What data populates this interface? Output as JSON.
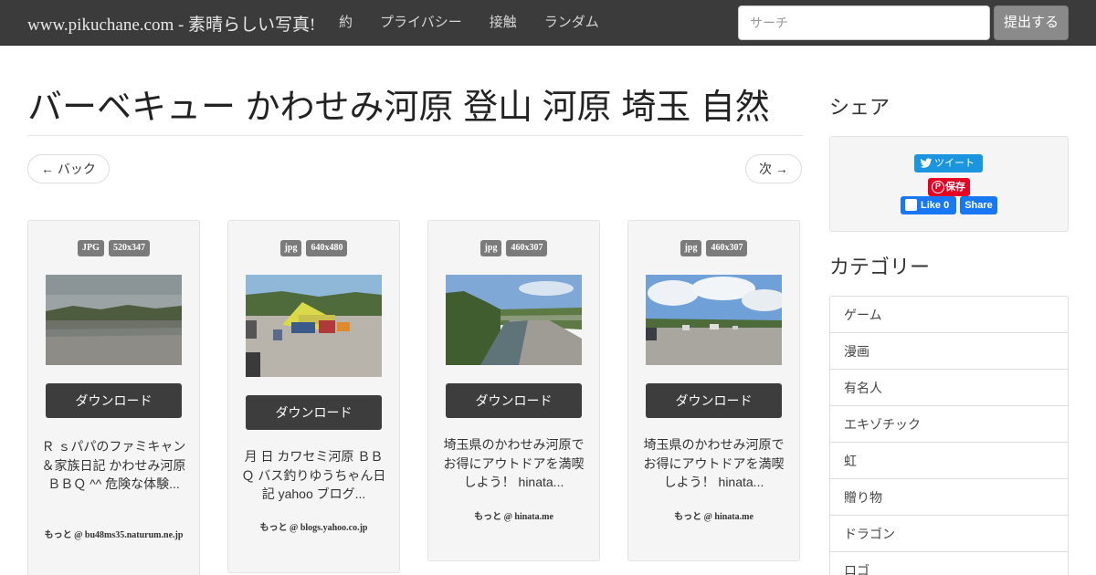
{
  "navbar": {
    "brand": "www.pikuchane.com - 素晴らしい写真!",
    "links": [
      "約",
      "プライバシー",
      "接触",
      "ランダム"
    ],
    "search_placeholder": "サーチ",
    "submit_label": "提出する"
  },
  "page": {
    "title": "バーベキュー かわせみ河原 登山 河原 埼玉 自然",
    "back_label": "← バック",
    "next_label": "次 →"
  },
  "cards": [
    {
      "format": "JPG",
      "size": "520x347",
      "download_label": "ダウンロード",
      "description": "Ｒ ｓパパのファミキャン＆家族日記 かわせみ河原ＢＢＱ ^^ 危険な体験...",
      "source": "もっと @ bu48ms35.naturum.ne.jp"
    },
    {
      "format": "jpg",
      "size": "640x480",
      "download_label": "ダウンロード",
      "description": "月 日 カワセミ河原 ＢＢＱ バス釣りゆうちゃん日記 yahoo ブログ...",
      "source": "もっと @ blogs.yahoo.co.jp"
    },
    {
      "format": "jpg",
      "size": "460x307",
      "download_label": "ダウンロード",
      "description": "埼玉県のかわせみ河原でお得にアウトドアを満喫しよう！ hinata...",
      "source": "もっと @ hinata.me"
    },
    {
      "format": "jpg",
      "size": "460x307",
      "download_label": "ダウンロード",
      "description": "埼玉県のかわせみ河原でお得にアウトドアを満喫しよう！ hinata...",
      "source": "もっと @ hinata.me"
    }
  ],
  "sidebar": {
    "share_heading": "シェア",
    "tweet_label": "ツイート",
    "pin_label": "保存",
    "fb_like_label": "Like 0",
    "fb_share_label": "Share",
    "category_heading": "カテゴリー",
    "categories": [
      "ゲーム",
      "漫画",
      "有名人",
      "エキゾチック",
      "虹",
      "贈り物",
      "ドラゴン",
      "ロゴ"
    ]
  },
  "colors": {
    "navbar_bg": "#3b3b3b",
    "button_dark": "#3d3d3d",
    "badge_bg": "#7b7b7b",
    "twitter_blue": "#1b95e0",
    "pinterest_red": "#e60023",
    "facebook_blue": "#1877f2"
  }
}
